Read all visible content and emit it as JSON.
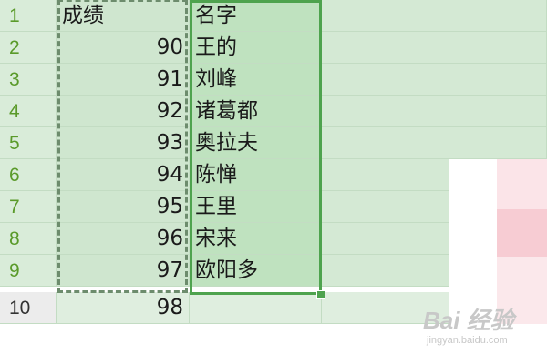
{
  "header": {
    "row_number": "1",
    "col_a": "成绩",
    "col_b": "名字"
  },
  "rows": [
    {
      "row_number": "2",
      "score": "90",
      "name": "王的"
    },
    {
      "row_number": "3",
      "score": "91",
      "name": "刘峰"
    },
    {
      "row_number": "4",
      "score": "92",
      "name": "诸葛都"
    },
    {
      "row_number": "5",
      "score": "93",
      "name": "奥拉夫"
    },
    {
      "row_number": "6",
      "score": "94",
      "name": "陈惮"
    },
    {
      "row_number": "7",
      "score": "95",
      "name": "王里"
    },
    {
      "row_number": "8",
      "score": "96",
      "name": "宋来"
    },
    {
      "row_number": "9",
      "score": "97",
      "name": "欧阳多"
    },
    {
      "row_number": "10",
      "score": "98",
      "name": ""
    }
  ],
  "watermark": {
    "brand": "Bai 经验",
    "url": "jingyan.baidu.com"
  },
  "colors": {
    "selection": "#4ea34e",
    "grid_fill": "#cfe6cf",
    "row_header_text": "#5a9a2a"
  }
}
